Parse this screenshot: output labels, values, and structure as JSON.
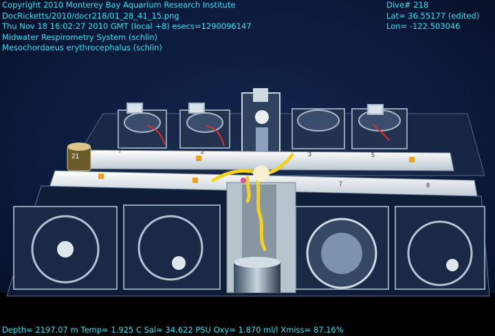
{
  "overlay": {
    "header_lines": [
      "Copyright 2010 Monterey Bay Aquarium Research Institute",
      "DocRicketts/2010/docr218/01_28_41_15.png",
      "Thu Nov 18 16:02:27 2010 GMT (local +8)  esecs=1290096147",
      "Midwater Respirometry System (schlin)",
      "Mesochordaeus erythrocephalus (schlin)"
    ],
    "dive": "Dive# 218",
    "lat": "Lat= 36.55177 (edited)",
    "lon": "Lon= -122.503046",
    "footer": "Depth= 2197.07 m  Temp= 1.925 C  Sal= 34.622 PSU  Oxy= 1.870 ml/l  Xmiss= 87.16%"
  },
  "scene_labels": {
    "bar_numbers": [
      "7",
      "2",
      "3",
      "5",
      "7",
      "8"
    ],
    "small_marker": "21"
  },
  "colors": {
    "overlay_text": "#23e6f0",
    "water": "#0a1838",
    "bar": "#e6eef2",
    "rope": "#f2d21e"
  }
}
